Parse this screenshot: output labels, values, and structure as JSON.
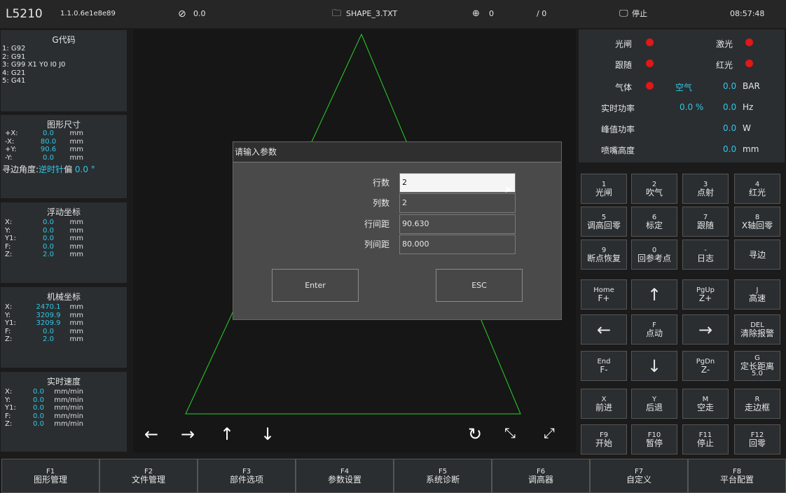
{
  "topbar": {
    "model": "L5210",
    "version": "1.1.0.6e1e8e89",
    "speed": "0.0",
    "file": "SHAPE_3.TXT",
    "count1": "0",
    "count2": "/ 0",
    "state": "停止",
    "time": "08:57:48"
  },
  "gcode": {
    "title": "G代码",
    "lines": [
      "1: G92",
      "2: G91",
      "3: G99 X1 Y0 I0 J0",
      "4: G21",
      "5: G41"
    ]
  },
  "shape": {
    "title": "图形尺寸",
    "rows": [
      {
        "l": "+X:",
        "v": "0.0",
        "u": "mm"
      },
      {
        "l": "-X:",
        "v": "80.0",
        "u": "mm"
      },
      {
        "l": "+Y:",
        "v": "90.6",
        "u": "mm"
      },
      {
        "l": "-Y:",
        "v": "0.0",
        "u": "mm"
      }
    ],
    "edge_label": "寻边角度:",
    "edge_dir": "逆时针",
    "offset_label": "偏",
    "offset_val": "0.0 °"
  },
  "float": {
    "title": "浮动坐标",
    "rows": [
      {
        "l": "X:",
        "v": "0.0",
        "u": "mm"
      },
      {
        "l": "Y:",
        "v": "0.0",
        "u": "mm"
      },
      {
        "l": "Y1:",
        "v": "0.0",
        "u": "mm"
      },
      {
        "l": "F:",
        "v": "0.0",
        "u": "mm"
      },
      {
        "l": "Z:",
        "v": "2.0",
        "u": "mm"
      }
    ]
  },
  "mech": {
    "title": "机械坐标",
    "rows": [
      {
        "l": "X:",
        "v": "2470.1",
        "u": "mm"
      },
      {
        "l": "Y:",
        "v": "3209.9",
        "u": "mm"
      },
      {
        "l": "Y1:",
        "v": "3209.9",
        "u": "mm"
      },
      {
        "l": "F:",
        "v": "0.0",
        "u": "mm"
      },
      {
        "l": "Z:",
        "v": "2.0",
        "u": "mm"
      }
    ]
  },
  "speed": {
    "title": "实时速度",
    "rows": [
      {
        "l": "X:",
        "v": "0.0",
        "u": "mm/min"
      },
      {
        "l": "Y:",
        "v": "0.0",
        "u": "mm/min"
      },
      {
        "l": "Y1:",
        "v": "0.0",
        "u": "mm/min"
      },
      {
        "l": "F:",
        "v": "0.0",
        "u": "mm/min"
      },
      {
        "l": "Z:",
        "v": "0.0",
        "u": "mm/min"
      }
    ]
  },
  "dialog": {
    "title": "请输入参数",
    "rows_label": "行数",
    "rows_val": "2",
    "cols_label": "列数",
    "cols_val": "2",
    "rowgap_label": "行间距",
    "rowgap_val": "90.630",
    "colgap_label": "列间距",
    "colgap_val": "80.000",
    "enter": "Enter",
    "esc": "ESC"
  },
  "status": {
    "shutter": "光闸",
    "laser": "激光",
    "follow": "跟随",
    "red": "红光",
    "gas": "气体",
    "air": "空气",
    "bar_val": "0.0",
    "bar_unit": "BAR",
    "rt_power": "实时功率",
    "rt_pct": "0.0 %",
    "hz_val": "0.0",
    "hz_unit": "Hz",
    "peak": "峰值功率",
    "w_val": "0.0",
    "w_unit": "W",
    "nozzle": "喷嘴高度",
    "mm_val": "0.0",
    "mm_unit": "mm"
  },
  "keys": [
    [
      "1",
      "光闸"
    ],
    [
      "2",
      "吹气"
    ],
    [
      "3",
      "点射"
    ],
    [
      "4",
      "红光"
    ],
    [
      "5",
      "调高回零"
    ],
    [
      "6",
      "标定"
    ],
    [
      "7",
      "跟随"
    ],
    [
      "8",
      "X轴回零"
    ],
    [
      "9",
      "断点恢复"
    ],
    [
      "0",
      "回参考点"
    ],
    [
      "-",
      "日志"
    ],
    [
      "",
      "寻边"
    ],
    [
      "Home",
      "F+"
    ],
    [
      "",
      "↑"
    ],
    [
      "PgUp",
      "Z+"
    ],
    [
      "J",
      "高速"
    ],
    [
      "",
      "←"
    ],
    [
      "F",
      "点动"
    ],
    [
      "",
      "→"
    ],
    [
      "DEL",
      "清除报警"
    ],
    [
      "End",
      "F-"
    ],
    [
      "",
      "↓"
    ],
    [
      "PgDn",
      "Z-"
    ],
    [
      "G",
      "定长距离",
      "5.0"
    ],
    [
      "X",
      "前进"
    ],
    [
      "Y",
      "后退"
    ],
    [
      "M",
      "空走"
    ],
    [
      "R",
      "走边框"
    ],
    [
      "F9",
      "开始"
    ],
    [
      "F10",
      "暂停"
    ],
    [
      "F11",
      "停止"
    ],
    [
      "F12",
      "回零"
    ]
  ],
  "fkeys": [
    [
      "F1",
      "图形管理"
    ],
    [
      "F2",
      "文件管理"
    ],
    [
      "F3",
      "部件选项"
    ],
    [
      "F4",
      "参数设置"
    ],
    [
      "F5",
      "系统诊断"
    ],
    [
      "F6",
      "调高器"
    ],
    [
      "F7",
      "自定义"
    ],
    [
      "F8",
      "平台配置"
    ]
  ],
  "controls": {
    "left": "←",
    "right": "→",
    "up": "↑",
    "down": "↓",
    "refresh": "↻",
    "shrink": "⤡",
    "expand": "⤢"
  },
  "colors": {
    "accent": "#2fc7e8",
    "led": "#e01818",
    "shape": "#27d427"
  }
}
